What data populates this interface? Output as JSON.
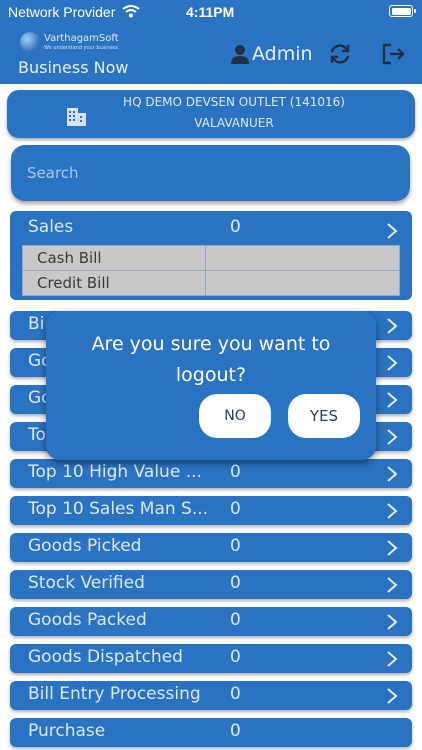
{
  "status_bar": {
    "carrier": "Network Provider",
    "time": "4:11PM"
  },
  "header": {
    "brand_name": "VarthagamSoft",
    "brand_tagline": "We understand your business",
    "app_title": "Business Now",
    "user_name": "Admin"
  },
  "outlet": {
    "name": "HQ DEMO DEVSEN OUTLET (141016)",
    "location": "VALAVANUER"
  },
  "search": {
    "placeholder": "Search"
  },
  "sales": {
    "label": "Sales",
    "count": "0",
    "rows": [
      {
        "label": "Cash Bill",
        "value": ""
      },
      {
        "label": "Credit Bill",
        "value": ""
      }
    ]
  },
  "reports": [
    {
      "label": "Bi",
      "count": ""
    },
    {
      "label": "Go",
      "count": ""
    },
    {
      "label": "Go",
      "count": ""
    },
    {
      "label": "To",
      "count": ""
    },
    {
      "label": "Top 10 High Value ...",
      "count": "0"
    },
    {
      "label": "Top 10 Sales Man S...",
      "count": "0"
    },
    {
      "label": "Goods Picked",
      "count": "0"
    },
    {
      "label": "Stock Verified",
      "count": "0"
    },
    {
      "label": "Goods Packed",
      "count": "0"
    },
    {
      "label": "Goods Dispatched",
      "count": "0"
    },
    {
      "label": "Bill Entry Processing",
      "count": "0"
    },
    {
      "label": "Purchase",
      "count": "0"
    }
  ],
  "dialog": {
    "message": "Are you sure you want to logout?",
    "no_label": "NO",
    "yes_label": "YES"
  },
  "colors": {
    "primary": "#2a73c2",
    "table_cell": "#c8c8c8",
    "dialog_button": "#ffffff"
  }
}
